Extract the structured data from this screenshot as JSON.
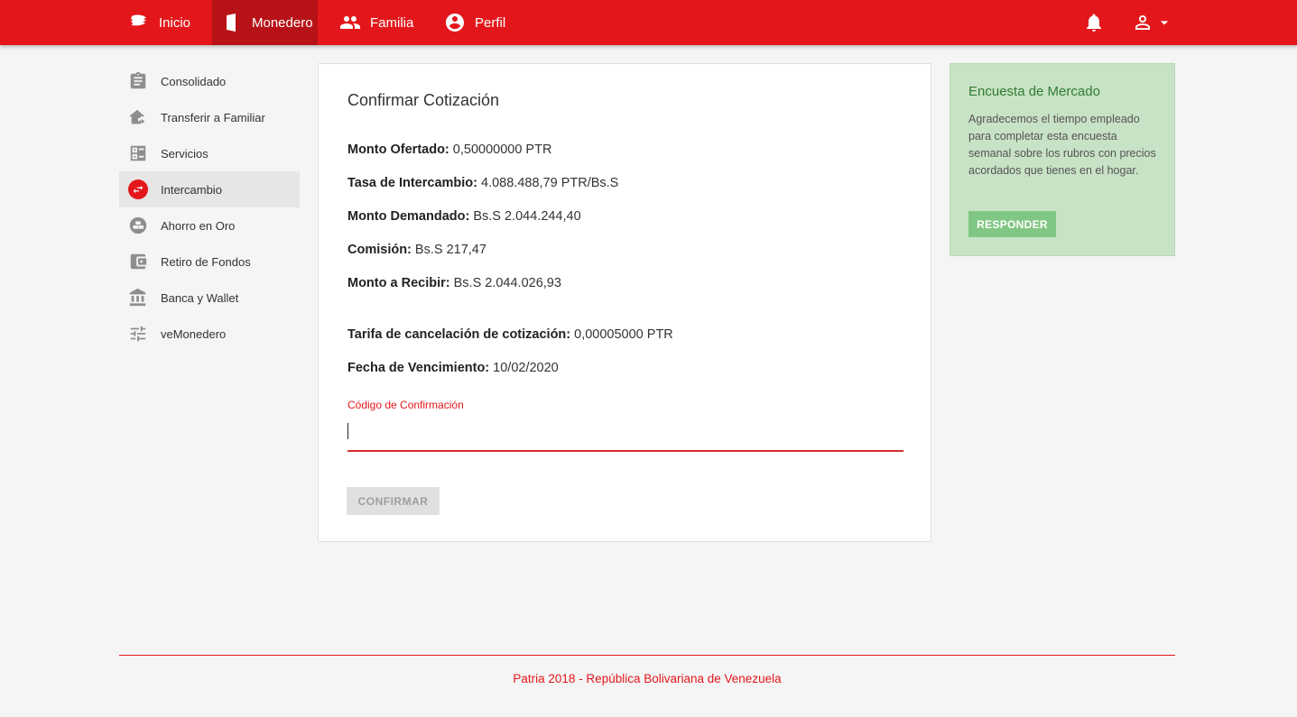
{
  "nav": {
    "inicio": "Inicio",
    "monedero": "Monedero",
    "familia": "Familia",
    "perfil": "Perfil"
  },
  "sidebar": {
    "items": [
      {
        "label": "Consolidado",
        "icon": "clipboard-icon"
      },
      {
        "label": "Transferir a Familiar",
        "icon": "home-transfer-icon"
      },
      {
        "label": "Servicios",
        "icon": "services-list-icon"
      },
      {
        "label": "Intercambio",
        "icon": "swap-icon",
        "active": true
      },
      {
        "label": "Ahorro en Oro",
        "icon": "gold-bars-icon"
      },
      {
        "label": "Retiro de Fondos",
        "icon": "wallet-icon"
      },
      {
        "label": "Banca y Wallet",
        "icon": "bank-icon"
      },
      {
        "label": "veMonedero",
        "icon": "sliders-icon"
      }
    ]
  },
  "quote": {
    "title": "Confirmar Cotización",
    "rows": [
      {
        "label": "Monto Ofertado:",
        "value": "0,50000000 PTR"
      },
      {
        "label": "Tasa de Intercambio:",
        "value": "4.088.488,79 PTR/Bs.S"
      },
      {
        "label": "Monto Demandado:",
        "value": "Bs.S 2.044.244,40"
      },
      {
        "label": "Comisión:",
        "value": "Bs.S 217,47"
      },
      {
        "label": "Monto a Recibir:",
        "value": "Bs.S 2.044.026,93"
      },
      {
        "label": "Tarifa de cancelación de cotización:",
        "value": "0,00005000 PTR"
      },
      {
        "label": "Fecha de Vencimiento:",
        "value": "10/02/2020"
      }
    ],
    "code_label": "Código de Confirmación",
    "code_value": "",
    "confirm_label": "CONFIRMAR"
  },
  "survey": {
    "title": "Encuesta de Mercado",
    "text": "Agradecemos el tiempo empleado para completar esta encuesta semanal sobre los rubros con precios acordados que tienes en el hogar.",
    "button": "RESPONDER"
  },
  "footer": {
    "text": "Patria 2018 - República Bolivariana de Venezuela"
  },
  "colors": {
    "brand": "#e3171b",
    "brand_dark": "#b71217",
    "survey_bg": "#c8e2c5",
    "survey_button": "#81c784"
  }
}
